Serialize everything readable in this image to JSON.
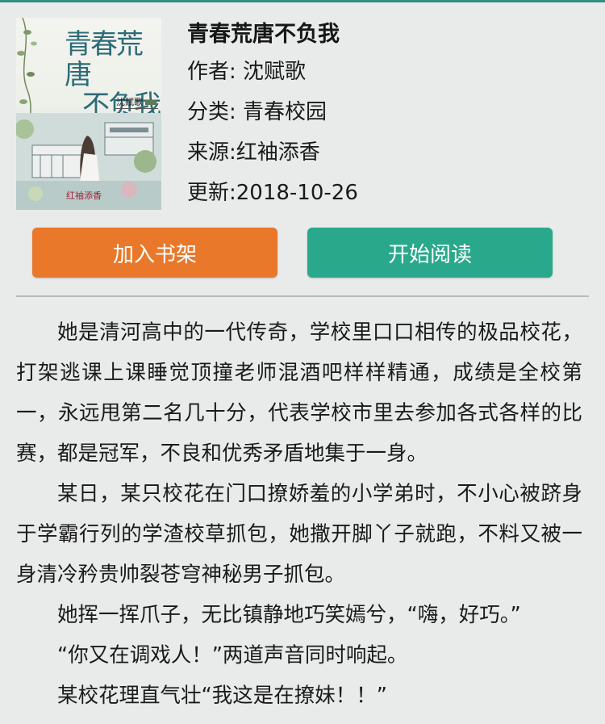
{
  "book": {
    "title": "青春荒唐不负我",
    "author_line": "作者: 沈赋歌",
    "category_line": "分类: 青春校园",
    "source_line": "来源:红袖添香",
    "updated_line": "更新:2018-10-26"
  },
  "cover": {
    "title_line1": "青春荒唐",
    "title_line2": "不负我",
    "author": "沈赋歌",
    "publisher_logo": "红袖添香"
  },
  "buttons": {
    "add_to_shelf": "加入书架",
    "start_reading": "开始阅读"
  },
  "colors": {
    "add_to_shelf": "#e9782a",
    "start_reading": "#2aa88b",
    "background": "#e9ebea"
  },
  "intro": {
    "paragraphs": [
      "她是清河高中的一代传奇，学校里口口相传的极品校花，打架逃课上课睡觉顶撞老师混酒吧样样精通，成绩是全校第一，永远甩第二名几十分，代表学校市里去参加各式各样的比赛，都是冠军，不良和优秀矛盾地集于一身。",
      "某日，某只校花在门口撩娇羞的小学弟时，不小心被跻身于学霸行列的学渣校草抓包，她撒开脚丫子就跑，不料又被一身清冷矜贵帅裂苍穹神秘男子抓包。",
      "她挥一挥爪子，无比镇静地巧笑嫣兮，“嗨，好巧。”",
      "“你又在调戏人！”两道声音同时响起。",
      "某校花理直气壮“我这是在撩妹！！”"
    ]
  }
}
